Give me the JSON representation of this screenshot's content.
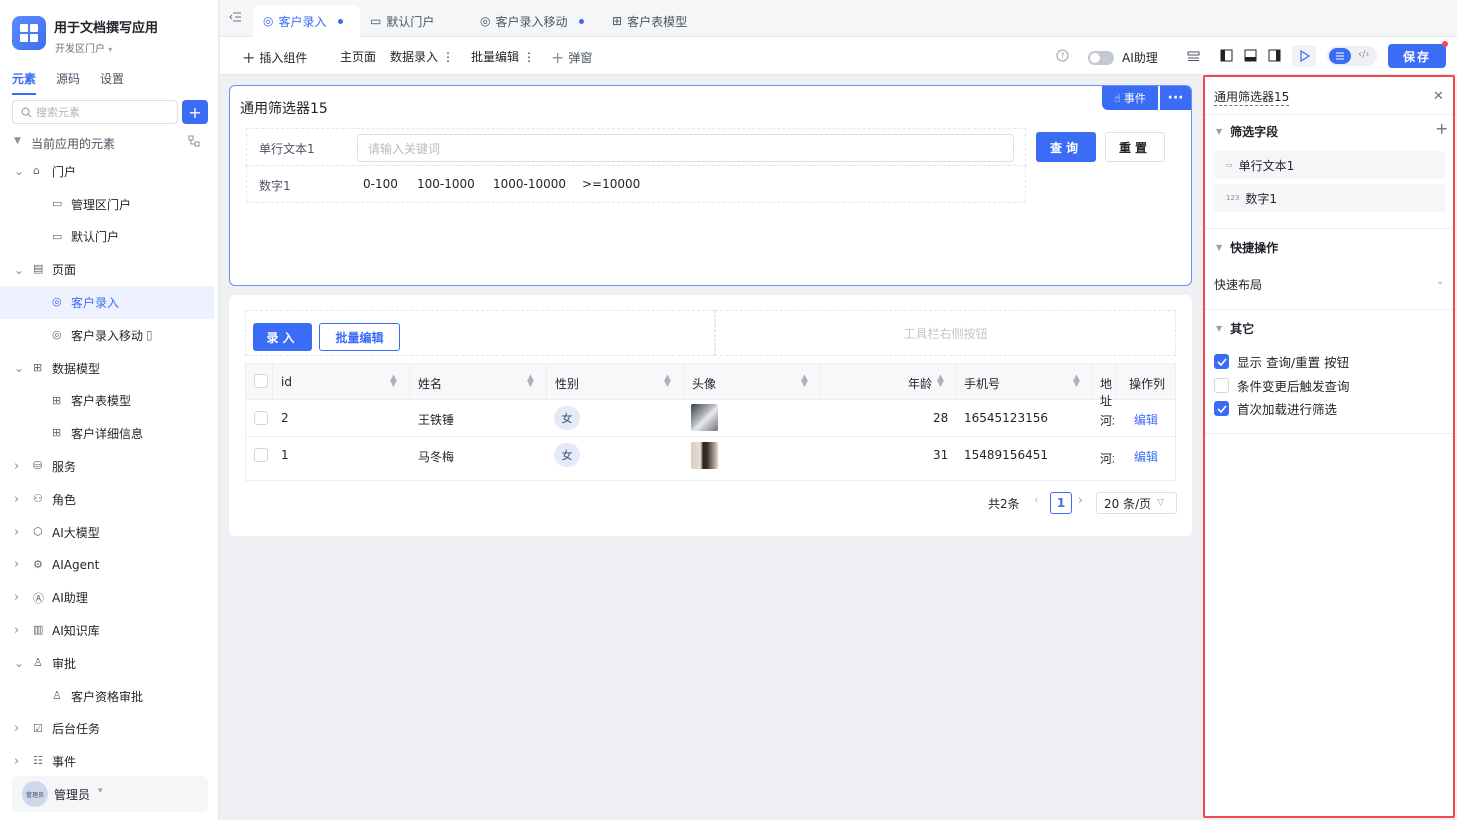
{
  "app": {
    "title": "用于文档撰写应用",
    "subtitle": "开发区门户"
  },
  "side_tabs": [
    "元素",
    "源码",
    "设置"
  ],
  "search": {
    "placeholder": "搜索元素"
  },
  "tree_header": "当前应用的元素",
  "tree": [
    {
      "label": "门户",
      "level": 1,
      "arrow": "down",
      "icon": "home-icon"
    },
    {
      "label": "管理区门户",
      "level": 2,
      "icon": "monitor-icon"
    },
    {
      "label": "默认门户",
      "level": 2,
      "icon": "monitor-icon"
    },
    {
      "label": "页面",
      "level": 1,
      "arrow": "down",
      "icon": "page-icon"
    },
    {
      "label": "客户录入",
      "level": 2,
      "icon": "globe-page-icon",
      "active": true
    },
    {
      "label": "客户录入移动",
      "level": 2,
      "icon": "globe-page-icon",
      "suffix_icon": "mobile-icon"
    },
    {
      "label": "数据模型",
      "level": 1,
      "arrow": "down",
      "icon": "table-icon"
    },
    {
      "label": "客户表模型",
      "level": 2,
      "icon": "table-icon"
    },
    {
      "label": "客户详细信息",
      "level": 2,
      "icon": "table-icon"
    },
    {
      "label": "服务",
      "level": 1,
      "arrow": "right",
      "icon": "service-icon"
    },
    {
      "label": "角色",
      "level": 1,
      "arrow": "right",
      "icon": "role-icon"
    },
    {
      "label": "AI大模型",
      "level": 1,
      "arrow": "right",
      "icon": "cube-icon"
    },
    {
      "label": "AIAgent",
      "level": 1,
      "arrow": "right",
      "icon": "robot-icon"
    },
    {
      "label": "AI助理",
      "level": 1,
      "arrow": "right",
      "icon": "ai-icon"
    },
    {
      "label": "AI知识库",
      "level": 1,
      "arrow": "right",
      "icon": "book-icon"
    },
    {
      "label": "审批",
      "level": 1,
      "arrow": "down",
      "icon": "stamp-icon"
    },
    {
      "label": "客户资格审批",
      "level": 2,
      "icon": "stamp-icon"
    },
    {
      "label": "后台任务",
      "level": 1,
      "arrow": "right",
      "icon": "task-icon"
    },
    {
      "label": "事件",
      "level": 1,
      "arrow": "right",
      "icon": "event-icon"
    }
  ],
  "user": {
    "name": "管理员",
    "avatar_text": "管理员"
  },
  "tabs": [
    {
      "label": "客户录入",
      "active": true,
      "dot": true
    },
    {
      "label": "默认门户"
    },
    {
      "label": "客户录入移动",
      "dot": true
    },
    {
      "label": "客户表模型"
    }
  ],
  "toolbar": {
    "insert": "插入组件",
    "home": "主页面",
    "data_entry": "数据录入",
    "batch_edit": "批量编辑",
    "popup": "弹窗",
    "ai_assistant": "AI助理",
    "save": "保存"
  },
  "filter": {
    "title": "通用筛选器15",
    "event_btn": "事件",
    "text_label": "单行文本1",
    "text_placeholder": "请输入关键词",
    "number_label": "数字1",
    "number_options": [
      "0-100",
      "100-1000",
      "1000-10000",
      ">=10000"
    ],
    "query_btn": "查询",
    "reset_btn": "重置"
  },
  "table": {
    "entry_btn": "录入",
    "batch_btn": "批量编辑",
    "toolbar_right": "工具栏右侧按钮",
    "columns": [
      "id",
      "姓名",
      "性别",
      "头像",
      "年龄",
      "手机号",
      "地址",
      "操作列"
    ],
    "rows": [
      {
        "id": "2",
        "name": "王铁锤",
        "gender": "女",
        "age": "28",
        "phone": "16545123156",
        "address": "河北",
        "action": "编辑"
      },
      {
        "id": "1",
        "name": "马冬梅",
        "gender": "女",
        "age": "31",
        "phone": "15489156451",
        "address": "河北",
        "action": "编辑"
      }
    ],
    "total": "共2条",
    "page": "1",
    "page_size": "20 条/页"
  },
  "panel": {
    "title": "通用筛选器15",
    "sec_fields": "筛选字段",
    "fields": [
      {
        "label": "单行文本1",
        "icon": "text-field-icon"
      },
      {
        "label": "数字1",
        "icon": "number-field-icon"
      }
    ],
    "sec_quick": "快捷操作",
    "quick_layout": "快速布局",
    "sec_other": "其它",
    "options": [
      {
        "label": "显示 查询/重置 按钮",
        "checked": true
      },
      {
        "label": "条件变更后触发查询",
        "checked": false
      },
      {
        "label": "首次加载进行筛选",
        "checked": true
      }
    ]
  },
  "colors": {
    "accent": "#3b6cf6",
    "highlight_border": "#f04b4b",
    "selected_bg": "#eef2ff"
  }
}
